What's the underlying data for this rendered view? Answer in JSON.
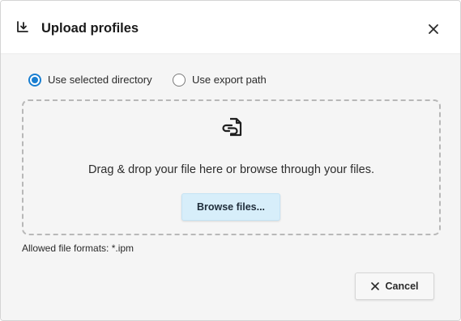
{
  "dialog": {
    "title": "Upload profiles",
    "title_icon": "upload-download-icon",
    "close_icon": "close-icon"
  },
  "options": {
    "items": [
      {
        "label": "Use selected directory",
        "checked": true
      },
      {
        "label": "Use export path",
        "checked": false
      }
    ]
  },
  "dropzone": {
    "icon": "file-link-icon",
    "message": "Drag & drop your file here or browse through your files.",
    "browse_label": "Browse files..."
  },
  "allowed_formats": "Allowed file formats: *.ipm",
  "footer": {
    "cancel_label": "Cancel",
    "cancel_icon": "close-icon"
  },
  "colors": {
    "accent": "#1a7fd1",
    "browse_bg": "#d7eefa",
    "body_bg": "#f5f5f5"
  }
}
